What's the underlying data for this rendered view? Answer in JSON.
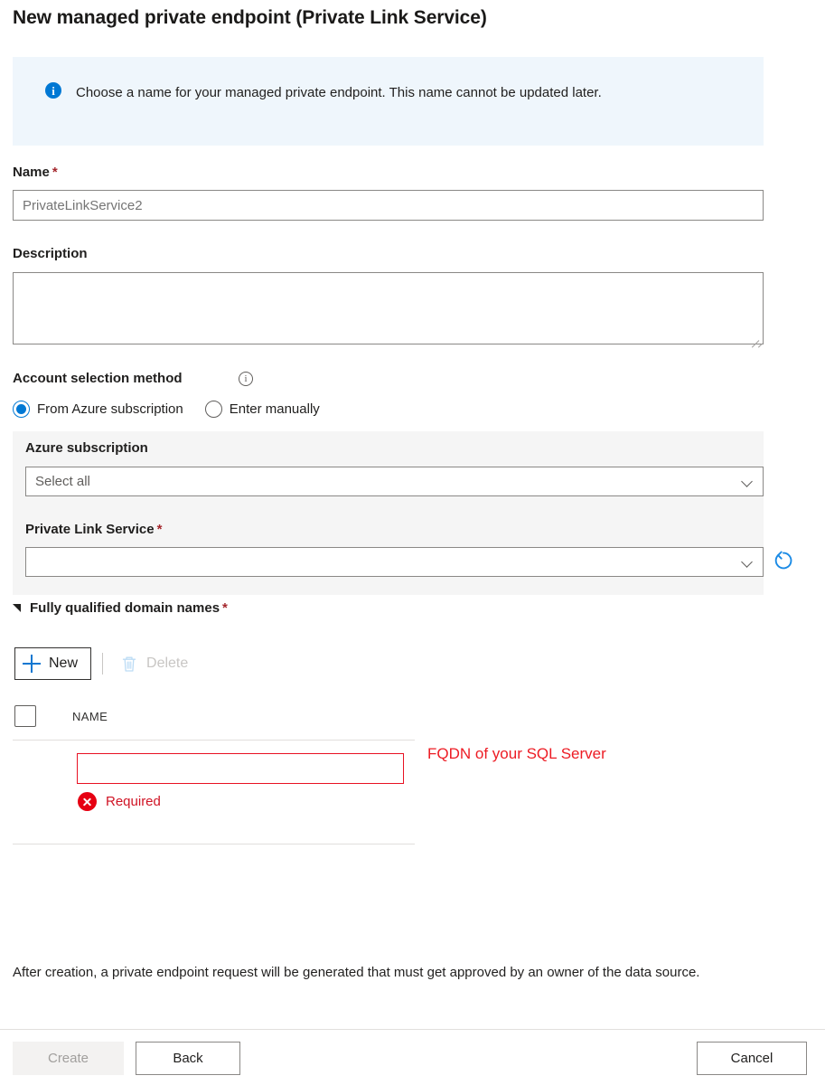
{
  "page": {
    "title": "New managed private endpoint (Private Link Service)"
  },
  "info_banner": {
    "icon": "info-circle-filled-icon",
    "text": "Choose a name for your managed private endpoint. This name cannot be updated later.",
    "background": "#eff6fc",
    "icon_color": "#0078d4"
  },
  "name_field": {
    "label": "Name",
    "required_marker": "*",
    "value": "",
    "placeholder": "PrivateLinkService2"
  },
  "description_field": {
    "label": "Description",
    "value": "",
    "placeholder": ""
  },
  "account_selection": {
    "label": "Account selection method",
    "info_icon": "info-circle-outline-icon",
    "options": [
      {
        "label": "From Azure subscription",
        "selected": true
      },
      {
        "label": "Enter manually",
        "selected": false
      }
    ]
  },
  "azure_subscription": {
    "label": "Azure subscription",
    "value": "Select all",
    "chevron": "chevron-down-icon"
  },
  "private_link_service": {
    "label": "Private Link Service",
    "required_marker": "*",
    "value": "",
    "chevron": "chevron-down-icon",
    "refresh_icon": "refresh-icon",
    "refresh_color": "#0078d4"
  },
  "fqdn_section": {
    "header": "Fully qualified domain names",
    "required_marker": "*",
    "expander": "triangle-expanded-icon",
    "toolbar": {
      "new_label": "New",
      "new_icon": "plus-icon",
      "delete_label": "Delete",
      "delete_icon": "trash-icon",
      "delete_disabled": true
    },
    "table": {
      "columns": [
        "NAME"
      ],
      "rows": [
        {
          "name_value": "",
          "error": "Required",
          "error_icon": "error-circle-icon",
          "error_color": "#e81123"
        }
      ]
    },
    "annotation": {
      "text": "FQDN of your SQL Server",
      "color": "#ed1c24"
    }
  },
  "footer": {
    "note": "After creation, a private endpoint request will be generated that must get approved by an owner of the data source.",
    "buttons": {
      "create": "Create",
      "back": "Back",
      "cancel": "Cancel"
    }
  }
}
